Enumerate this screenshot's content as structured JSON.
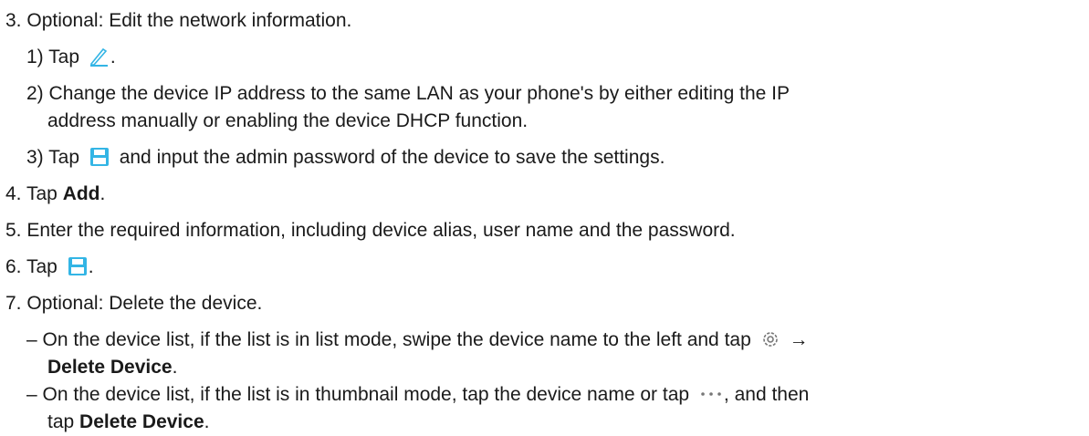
{
  "steps": {
    "s3": {
      "num": "3.",
      "text": "Optional: Edit the network information."
    },
    "s3_1": {
      "num": "1)",
      "pre": "Tap",
      "post": "."
    },
    "s3_2": {
      "num": "2)",
      "line1": "Change the device IP address to the same LAN as your phone's by either editing the IP",
      "line2": "address manually or enabling the device DHCP function."
    },
    "s3_3": {
      "num": "3)",
      "pre": "Tap",
      "post": "and input the admin password of the device to save the settings."
    },
    "s4": {
      "num": "4.",
      "pre": "Tap",
      "bold": "Add",
      "post": "."
    },
    "s5": {
      "num": "5.",
      "text": "Enter the required information, including device alias, user name and the password."
    },
    "s6": {
      "num": "6.",
      "pre": "Tap",
      "post": "."
    },
    "s7": {
      "num": "7.",
      "text": "Optional: Delete the device."
    },
    "bullet1": {
      "dash": "–",
      "line1": "On the device list, if the list is in list mode, swipe the device name to the left and tap",
      "arrow": "→",
      "bold": "Delete Device",
      "post": "."
    },
    "bullet2": {
      "dash": "–",
      "line1_pre": "On the device list, if the list is in thumbnail mode, tap the device name or tap",
      "line1_post": ", and then",
      "line2_pre": "tap",
      "bold": "Delete Device",
      "post": "."
    }
  },
  "icons": {
    "edit": "edit-pencil-icon",
    "save": "save-floppy-icon",
    "settings": "gear-icon",
    "more": "more-dots-icon"
  },
  "colors": {
    "icon_accent": "#33b5e5"
  }
}
